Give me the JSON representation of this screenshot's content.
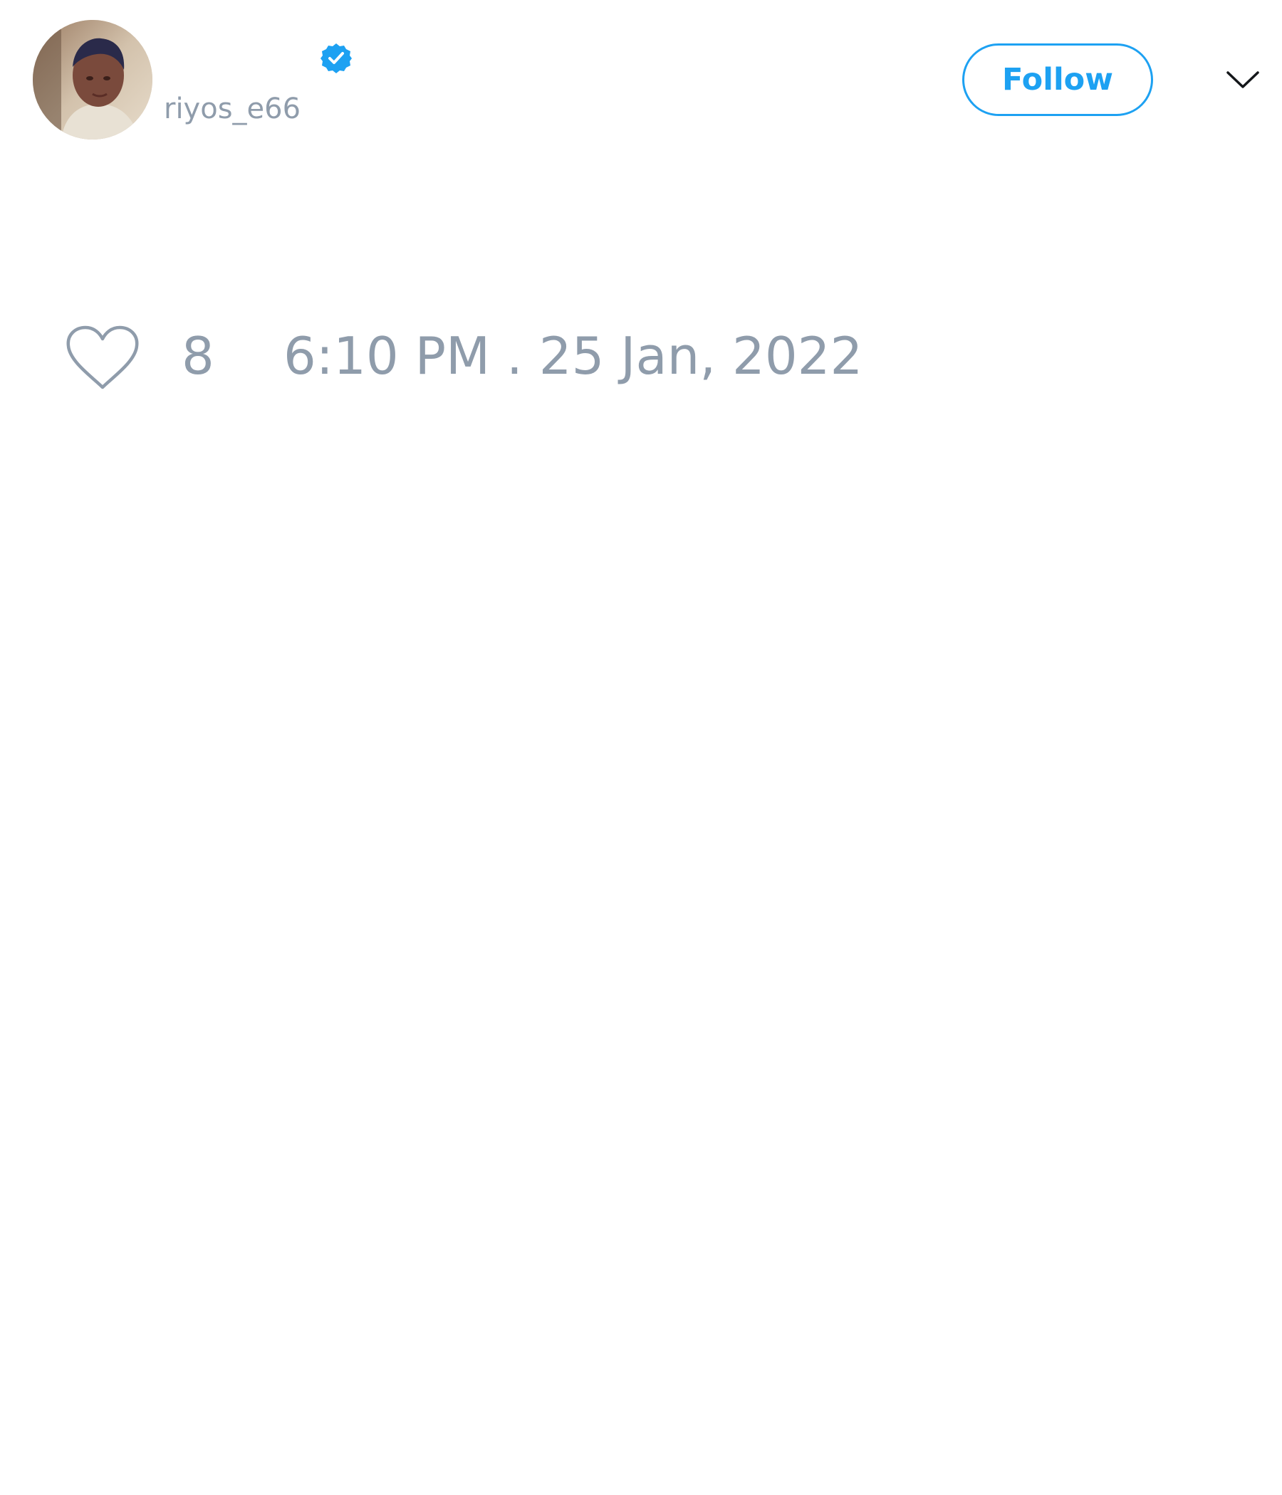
{
  "tweet": {
    "author": {
      "display_name": "",
      "handle": "riyos_e66",
      "verified": true,
      "avatar_icon": "profile-photo"
    },
    "follow_label": "Follow",
    "more_icon": "chevron-down-icon",
    "like_icon": "heart-icon",
    "like_count": "8",
    "timestamp": "6:10 PM . 25 Jan, 2022"
  },
  "colors": {
    "accent": "#1da1f2",
    "muted_text": "#8f9cab",
    "background": "#ffffff"
  }
}
